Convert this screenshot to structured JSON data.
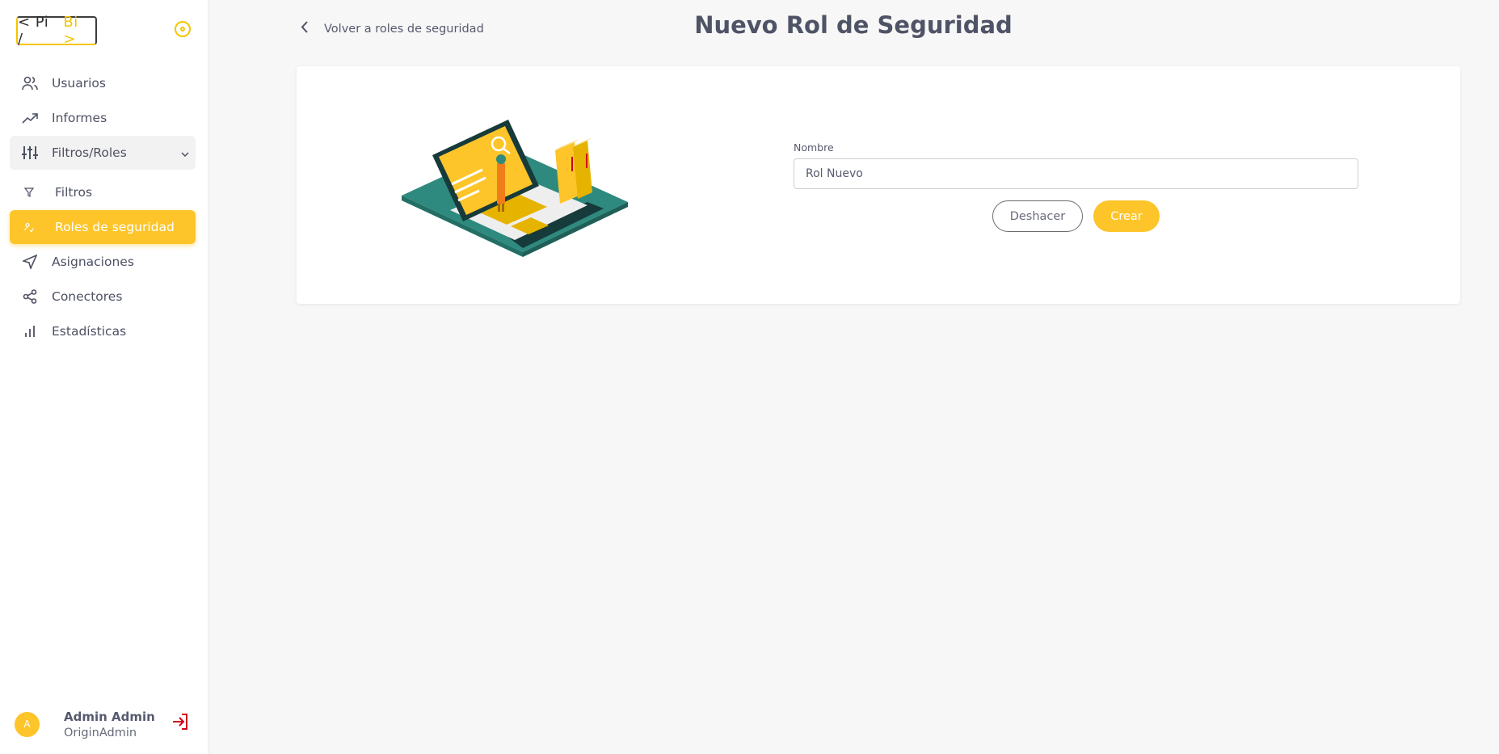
{
  "logo": {
    "left": "< Pi /",
    "right": "Bi >"
  },
  "sidebar": {
    "items": [
      {
        "label": "Usuarios",
        "icon": "users-icon"
      },
      {
        "label": "Informes",
        "icon": "trending-up-icon"
      },
      {
        "label": "Filtros/Roles",
        "icon": "sliders-icon"
      },
      {
        "label": "Filtros",
        "icon": "filter-icon"
      },
      {
        "label": "Roles de seguridad",
        "icon": "user-shield-icon"
      },
      {
        "label": "Asignaciones",
        "icon": "send-icon"
      },
      {
        "label": "Conectores",
        "icon": "share-icon"
      },
      {
        "label": "Estadísticas",
        "icon": "bar-chart-icon"
      }
    ]
  },
  "user": {
    "initial": "A",
    "name": "Admin Admin",
    "role": "OriginAdmin"
  },
  "header": {
    "back_label": "Volver a roles de seguridad",
    "title": "Nuevo Rol de Seguridad"
  },
  "form": {
    "name_label": "Nombre",
    "name_value": "Rol Nuevo",
    "undo_label": "Deshacer",
    "create_label": "Crear"
  },
  "colors": {
    "accent": "#fdc52a",
    "text": "#555a6e",
    "danger": "#d0021b",
    "teal": "#2e8a7e"
  }
}
